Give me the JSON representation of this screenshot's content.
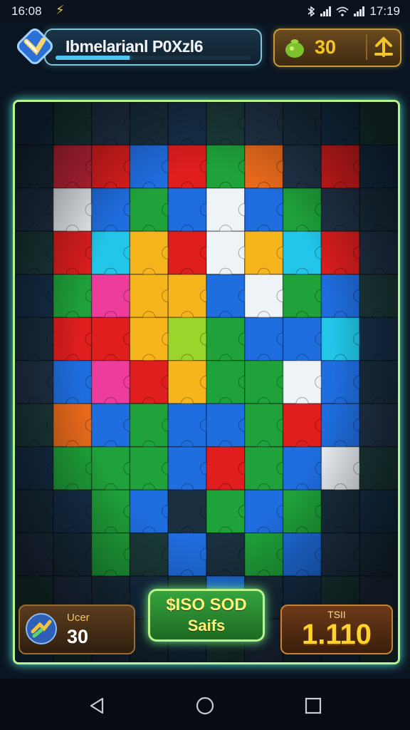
{
  "status_bar": {
    "time": "16:08",
    "clock": "17:19",
    "icons": [
      "flash-icon",
      "bluetooth-icon",
      "signal-icon",
      "wifi-icon",
      "signal-icon"
    ]
  },
  "header": {
    "title": "Ibmelarianl P0Xzl6",
    "level_progress": 0.38,
    "coins": "30",
    "icons": [
      "puzzle-logo-icon",
      "money-bag-icon",
      "boost-icon"
    ]
  },
  "board": {
    "rows": 13,
    "cols": 10
  },
  "hud": {
    "user_label": "Ucer",
    "user_score": "30",
    "action_line1": "$ISO SOD",
    "action_line2": "Saifs",
    "score_label": "TSII",
    "score_value": "1.110"
  },
  "navigation": {
    "icons": [
      "back-icon",
      "home-icon",
      "recents-icon"
    ]
  },
  "colors": {
    "board_glow": "#4fe2d0",
    "accent_gold": "#f3c52b",
    "action_green": "#35a43e"
  }
}
